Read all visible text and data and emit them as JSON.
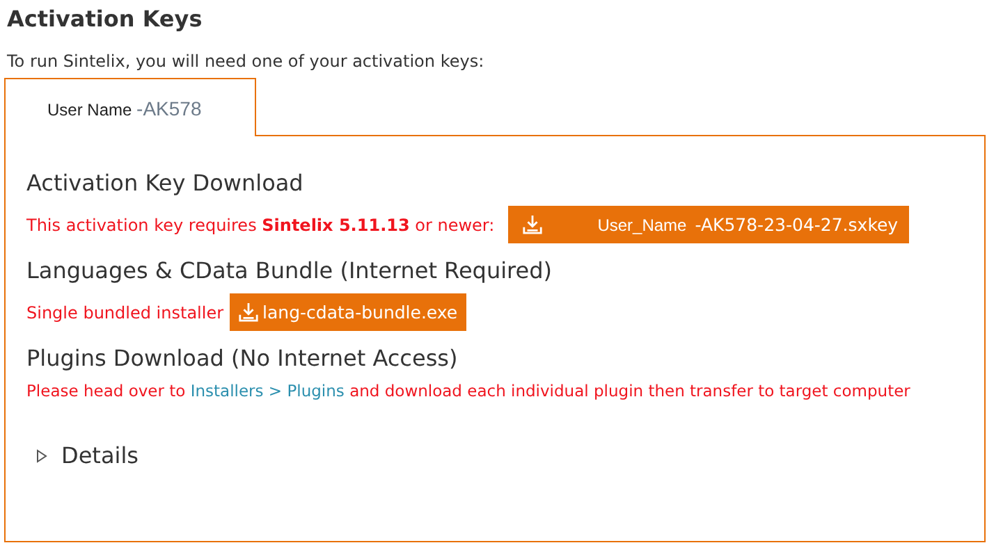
{
  "title": "Activation Keys",
  "intro": "To run Sintelix, you will need one of your activation keys:",
  "tabs": [
    {
      "user": "User Name",
      "key": "-AK578",
      "selected": true
    }
  ],
  "sections": [
    {
      "kind": "key",
      "heading": "Activation Key Download",
      "note": "This activation key requires **Sintelix 5.11.13** or newer:",
      "file_user": "User_Name",
      "file_name": "-AK578-23-04-27.sxkey"
    },
    {
      "kind": "bundle",
      "heading": "Languages & CData Bundle (Internet Required)",
      "note": "Single bundled installer",
      "file_name": "lang-cdata-bundle.exe"
    },
    {
      "kind": "plugins",
      "heading": "Plugins Download (No Internet Access)",
      "parts": [
        {
          "kind": "text",
          "text": "Please head over to"
        },
        {
          "kind": "link",
          "text": "Installers"
        },
        {
          "kind": "link",
          "text": ">"
        },
        {
          "kind": "link",
          "text": "Plugins"
        },
        {
          "kind": "text",
          "text": "and download each individual plugin then transfer to target computer"
        }
      ]
    }
  ],
  "details": {
    "label": "Details",
    "expanded": false
  }
}
